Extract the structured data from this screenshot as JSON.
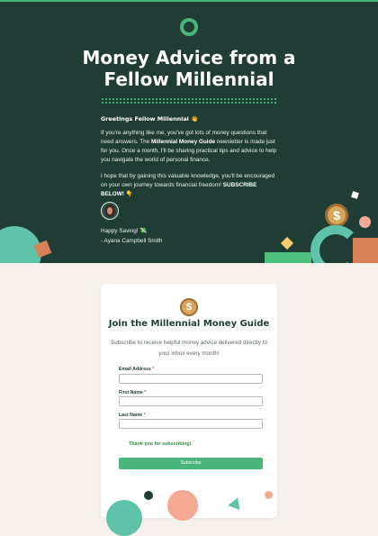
{
  "hero": {
    "title": "Money Advice from a Fellow Millennial",
    "greeting": "Greetings Fellow Millennial",
    "greeting_emoji": "👋",
    "para1_a": "If you're anything like me, you've got lots of money questions that need answers. The ",
    "para1_bold": "Millennial Money Guide",
    "para1_b": " newsletter is made just for you. Once a month, I'll be sharing practical tips and advice to help you navigate the world of personal finance.",
    "para2_a": "I hope that by gaining this valuable knowledge, you'll be encouraged on your own journey towards financial freedom! ",
    "para2_bold": "SUBSCRIBE BELOW!",
    "para2_emoji": "👇",
    "signoff_line1": "Happy Saving! 💸",
    "signoff_line2": "- Ayana Campbell Smith"
  },
  "card": {
    "coin_symbol": "$",
    "title": "Join the Millennial Money Guide",
    "subtitle": "Subscribe to receive helpful money advice delivered directly to your inbox every month!",
    "fields": [
      {
        "label": "Email Address",
        "required_mark": "*",
        "value": ""
      },
      {
        "label": "First Name",
        "required_mark": "*",
        "value": ""
      },
      {
        "label": "Last Name",
        "required_mark": "*",
        "value": ""
      }
    ],
    "thanks_message": "Thank you for subscribing!",
    "submit_label": "Subscribe"
  },
  "decor": {
    "hero_coin_symbol": "$"
  },
  "colors": {
    "hero_bg": "#1f3d35",
    "accent_green": "#49b57a",
    "teal": "#5fc3a9",
    "orange": "#d98058",
    "pink": "#f4a995",
    "gold": "#d7a55b",
    "page_bg": "#f6f1ec"
  }
}
